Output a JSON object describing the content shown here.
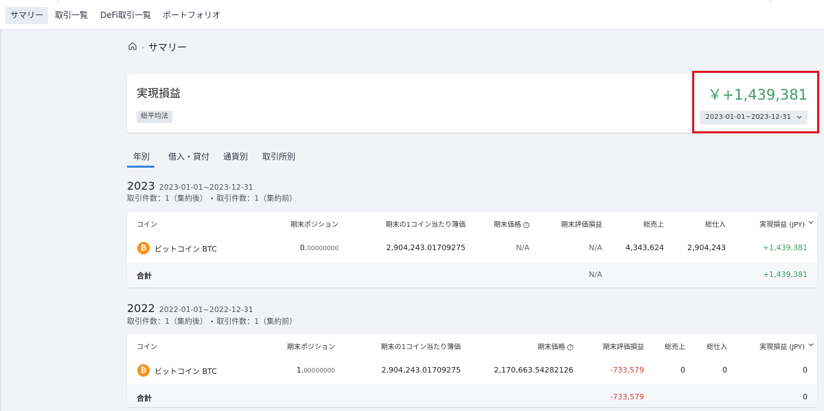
{
  "nav": {
    "tabs": [
      "サマリー",
      "取引一覧",
      "DeFi取引一覧",
      "ポートフォリオ"
    ]
  },
  "breadcrumb": {
    "current": "サマリー"
  },
  "summary": {
    "title": "実現損益",
    "method_badge": "総平均法",
    "total": "￥+1,439,381",
    "date_range": "2023-01-01~2023-12-31"
  },
  "subtabs": [
    "年別",
    "借入・貸付",
    "通貨別",
    "取引所別"
  ],
  "years": [
    {
      "year": "2023",
      "range": "2023-01-01~2023-12-31",
      "count_after": "取引件数：1（集約後）",
      "count_before": "取引件数：1（集約前）",
      "headers": [
        "コイン",
        "期末ポジション",
        "期末の1コイン当たり簿価",
        "期末価格",
        "期末評価損益",
        "総売上",
        "総仕入",
        "実現損益 (JPY)"
      ],
      "row": {
        "coin": "ビットコイン BTC",
        "pos_int": "0.",
        "pos_dec": "00000000",
        "book": "2,904,243.01709275",
        "price": "N/A",
        "eval": "N/A",
        "sales": "4,343,624",
        "purchase": "2,904,243",
        "realized": "+1,439,381"
      },
      "total": {
        "label": "合計",
        "eval": "N/A",
        "realized": "+1,439,381"
      }
    },
    {
      "year": "2022",
      "range": "2022-01-01~2022-12-31",
      "count_after": "取引件数：1（集約後）",
      "count_before": "取引件数：1（集約前）",
      "headers": [
        "コイン",
        "期末ポジション",
        "期末の1コイン当たり簿価",
        "期末価格",
        "期末評価損益",
        "総売上",
        "総仕入",
        "実現損益 (JPY)"
      ],
      "row": {
        "coin": "ビットコイン BTC",
        "pos_int": "1.",
        "pos_dec": "00000000",
        "book": "2,904,243.01709275",
        "price": "2,170,663.54282126",
        "eval": "-733,579",
        "sales": "0",
        "purchase": "0",
        "realized": "0"
      },
      "total": {
        "label": "合計",
        "eval": "-733,579",
        "realized": "0"
      }
    }
  ],
  "colors": {
    "positive": "#3b9e63",
    "negative": "#d0413f",
    "highlight": "#e0141e",
    "accent": "#3a86d8"
  }
}
